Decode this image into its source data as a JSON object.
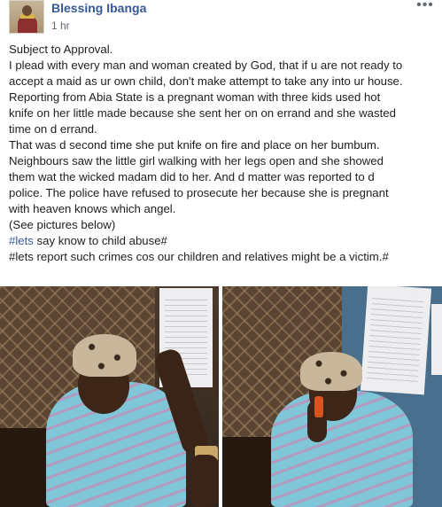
{
  "post": {
    "author": "Blessing Ibanga",
    "timestamp": "1 hr",
    "more_icon": "more-horizontal-icon",
    "text_lines": [
      "Subject to Approval.",
      "I plead with every man and woman created by God, that if u are not ready to",
      "accept a maid as ur own child, don't make attempt to take any into ur house.",
      "Reporting from Abia State is a pregnant woman with three kids used hot",
      "knife on her little made because she sent her on on errand and she wasted",
      "time on d errand.",
      "That was d second time she put knife on fire and place on her bumbum.",
      "Neighbours saw the little girl walking with her legs open and she showed",
      "them wat the wicked madam did to her. And d matter was reported to d",
      "police. The police have refused to prosecute her because she is pregnant",
      "with heaven knows which angel.",
      "(See pictures below)"
    ],
    "hashtag_line_1": {
      "tag": "#lets",
      "rest": " say know to child abuse#"
    },
    "hashtag_line_2": "#lets report such crimes cos our children and relatives might be a victim.#",
    "photos": [
      {
        "name": "photo-1"
      },
      {
        "name": "photo-2"
      }
    ]
  }
}
